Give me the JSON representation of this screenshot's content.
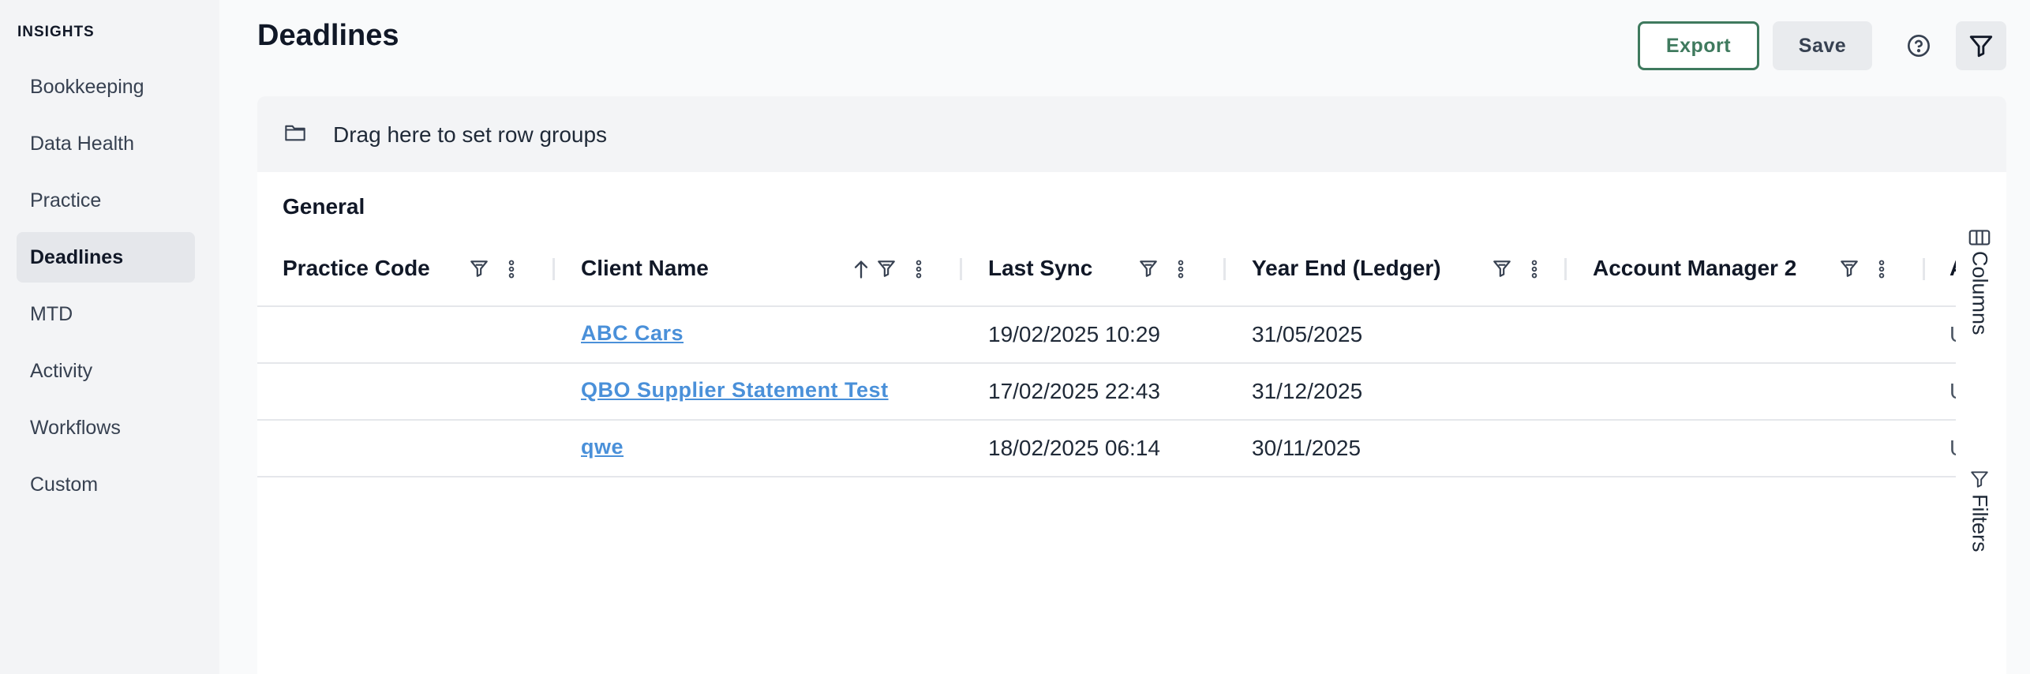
{
  "sidebar": {
    "heading": "INSIGHTS",
    "items": [
      {
        "label": "Bookkeeping"
      },
      {
        "label": "Data Health"
      },
      {
        "label": "Practice"
      },
      {
        "label": "Deadlines"
      },
      {
        "label": "MTD"
      },
      {
        "label": "Activity"
      },
      {
        "label": "Workflows"
      },
      {
        "label": "Custom"
      }
    ]
  },
  "header": {
    "title": "Deadlines",
    "export_label": "Export",
    "save_label": "Save"
  },
  "grid": {
    "row_group_hint": "Drag here to set row groups",
    "group_header": "General",
    "columns": [
      {
        "label": "Practice Code"
      },
      {
        "label": "Client Name"
      },
      {
        "label": "Last Sync"
      },
      {
        "label": "Year End (Ledger)"
      },
      {
        "label": "Account Manager 2"
      },
      {
        "label": "A"
      }
    ],
    "rows": [
      {
        "client": "ABC Cars",
        "last_sync": "19/02/2025 10:29",
        "year_end": "31/05/2025",
        "clipped": "U"
      },
      {
        "client": "QBO Supplier Statement Test",
        "last_sync": "17/02/2025 22:43",
        "year_end": "31/12/2025",
        "clipped": "U"
      },
      {
        "client": "qwe",
        "last_sync": "18/02/2025 06:14",
        "year_end": "30/11/2025",
        "clipped": "U"
      }
    ],
    "side_tools": {
      "columns_label": "Columns",
      "filters_label": "Filters"
    }
  },
  "colors": {
    "accent": "#3f7a5e",
    "link": "#4a90d9"
  },
  "icons": [
    "folder-icon",
    "filter-icon",
    "kebab-menu-icon",
    "sort-ascending-icon",
    "help-icon",
    "columns-icon"
  ]
}
